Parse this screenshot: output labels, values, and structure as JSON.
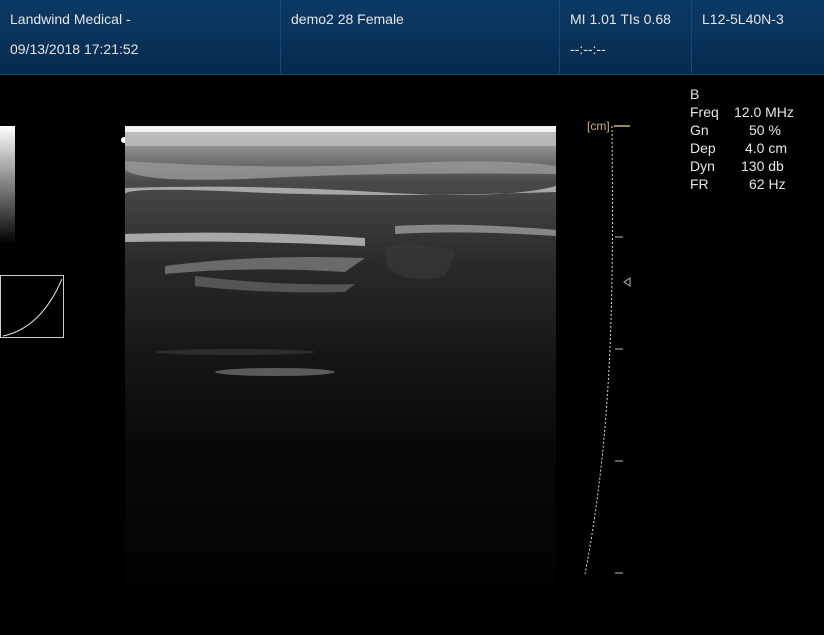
{
  "header": {
    "org_line1": "Landwind Medical -",
    "datetime": "09/13/2018 17:21:52",
    "patient": "demo2 28 Female",
    "indices": "MI 1.01 TIs 0.68",
    "time_placeholder": "--:--:--",
    "probe": "L12-5L40N-3"
  },
  "scale": {
    "unit_label": "[cm]"
  },
  "params": {
    "mode": "B",
    "rows": [
      {
        "key": "Freq",
        "value": "12.0 MHz"
      },
      {
        "key": "Gn",
        "value": "50 %"
      },
      {
        "key": "Dep",
        "value": "4.0 cm"
      },
      {
        "key": "Dyn",
        "value": "130 db"
      },
      {
        "key": "FR",
        "value": "62 Hz"
      }
    ]
  }
}
